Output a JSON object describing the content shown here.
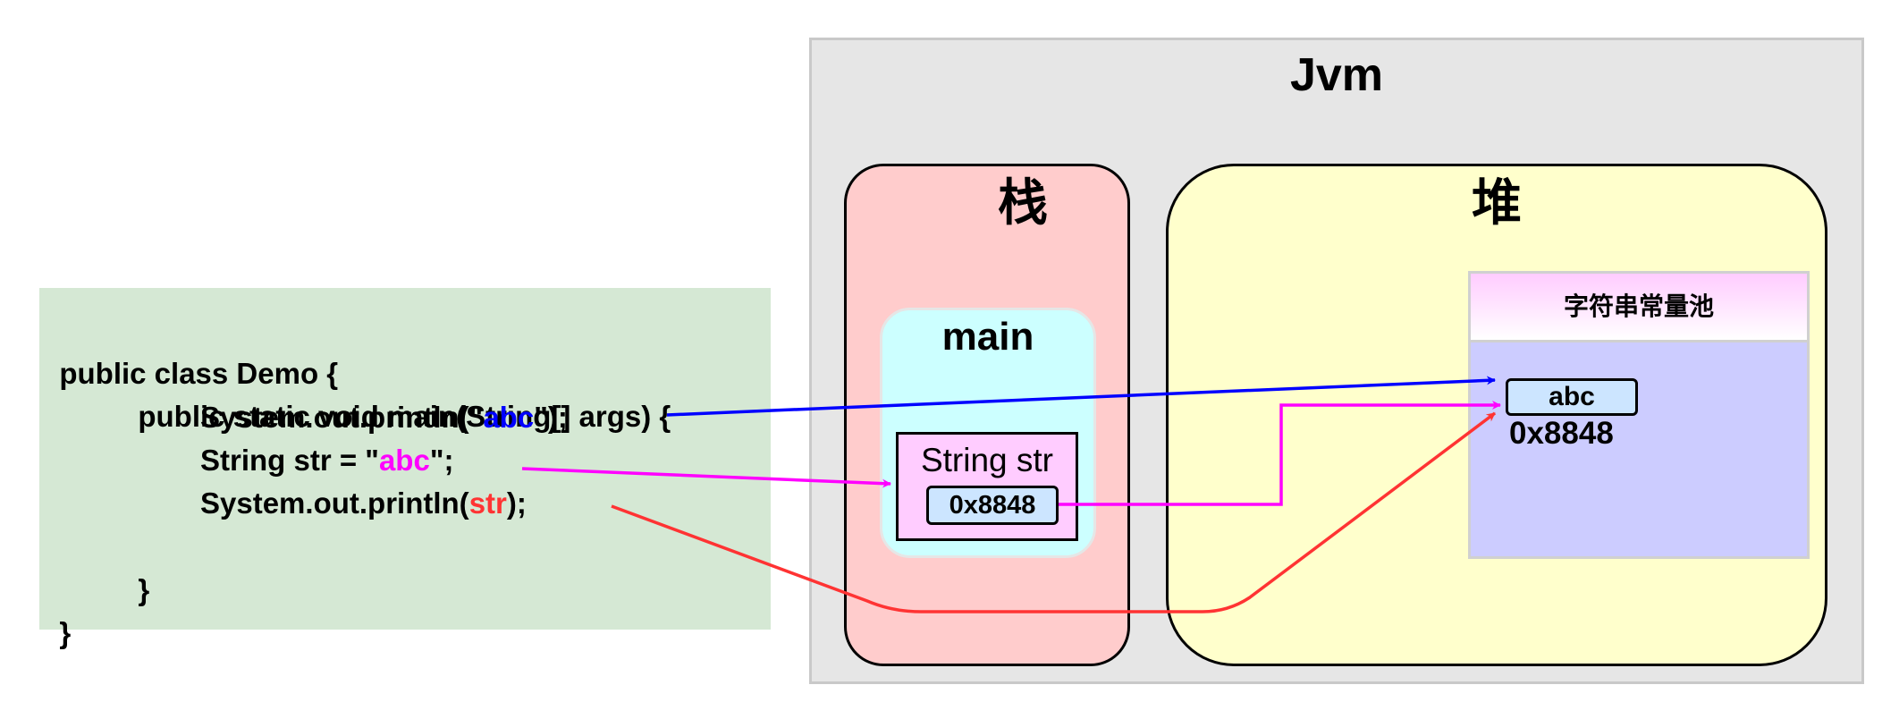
{
  "code": {
    "line1": "public class Demo {",
    "line2": "public static void main(String[] args) {",
    "line3_pre": "System.out.println(\"",
    "line3_hl": "abc",
    "line3_post": "\");",
    "line4_pre": "String str = \"",
    "line4_hl": "abc",
    "line4_post": "\";",
    "line5_pre": "System.out.println(",
    "line5_hl": "str",
    "line5_post": ");",
    "line6": "}",
    "line7": "}"
  },
  "jvm": {
    "title": "Jvm",
    "stack": {
      "title": "栈",
      "frame_title": "main",
      "variable_label": "String str",
      "variable_value": "0x8848"
    },
    "heap": {
      "title": "堆",
      "pool_title": "字符串常量池",
      "entry_value": "abc",
      "entry_address": "0x8848"
    }
  },
  "colors": {
    "code_bg": "#d5e8d4",
    "jvm_bg": "#e6e6e6",
    "stack_bg": "#ffcccc",
    "heap_bg": "#ffffcc",
    "main_bg": "#ccffff",
    "variable_bg": "#ffccff",
    "pool_bg": "#ccccff",
    "value_box_bg": "#cce5ff",
    "arrow_println_literal": "#0000ff",
    "arrow_assignment": "#ff00ff",
    "arrow_println_var": "#ff3333"
  }
}
